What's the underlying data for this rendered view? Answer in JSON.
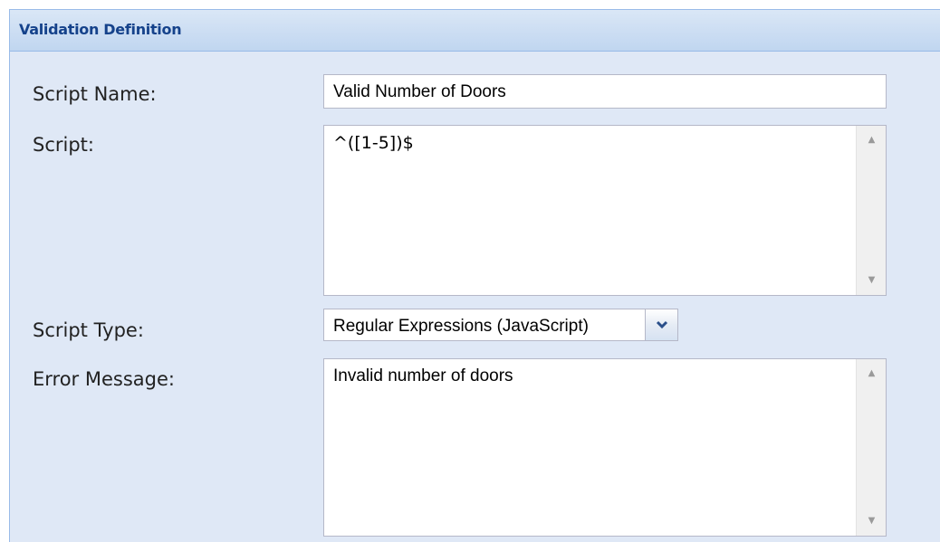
{
  "panel": {
    "title": "Validation Definition"
  },
  "form": {
    "script_name": {
      "label": "Script Name:",
      "value": "Valid Number of Doors"
    },
    "script": {
      "label": "Script:",
      "value": "^([1-5])$"
    },
    "script_type": {
      "label": "Script Type:",
      "selected": "Regular Expressions (JavaScript)"
    },
    "error_message": {
      "label": "Error Message:",
      "value": "Invalid number of doors"
    }
  },
  "icons": {
    "scroll_up": "scroll-up-arrow-icon",
    "scroll_down": "scroll-down-arrow-icon",
    "dropdown": "chevron-down-icon"
  },
  "colors": {
    "panel_bg": "#dfe8f6",
    "header_text": "#15428b",
    "border": "#99bbe8"
  }
}
